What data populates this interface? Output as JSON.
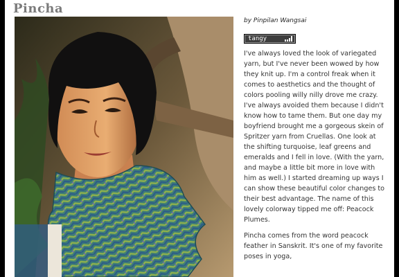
{
  "page": {
    "title": "Pincha"
  },
  "article": {
    "byline": "by Pinpilan Wangsai",
    "tag": {
      "label": "tangy",
      "icon": "signal-bars-icon"
    },
    "paragraphs": [
      "I've always loved the look of variegated yarn, but I've never been wowed by how they knit up. I'm a control freak when it comes to aesthetics and the thought of colors pooling willy nilly drove me crazy. I've always avoided them because I didn't know how to tame them. But one day my boyfriend brought me a gorgeous skein of Spritzer yarn from Cruellas. One look at the shifting turquoise, leaf greens and emeralds and I fell in love. (With the yarn, and maybe a little bit more in love with him as well.) I started dreaming up ways I can show these beautiful color changes to their best advantage. The name of this lovely colorway tipped me off: Peacock Plumes.",
      "Pincha comes from the word peacock feather in Sanskrit. It's one of my favorite poses in yoga,"
    ]
  },
  "colors": {
    "title": "#7b7b7b",
    "frame": "#000000",
    "tag_bg": "#3d3d3d"
  }
}
